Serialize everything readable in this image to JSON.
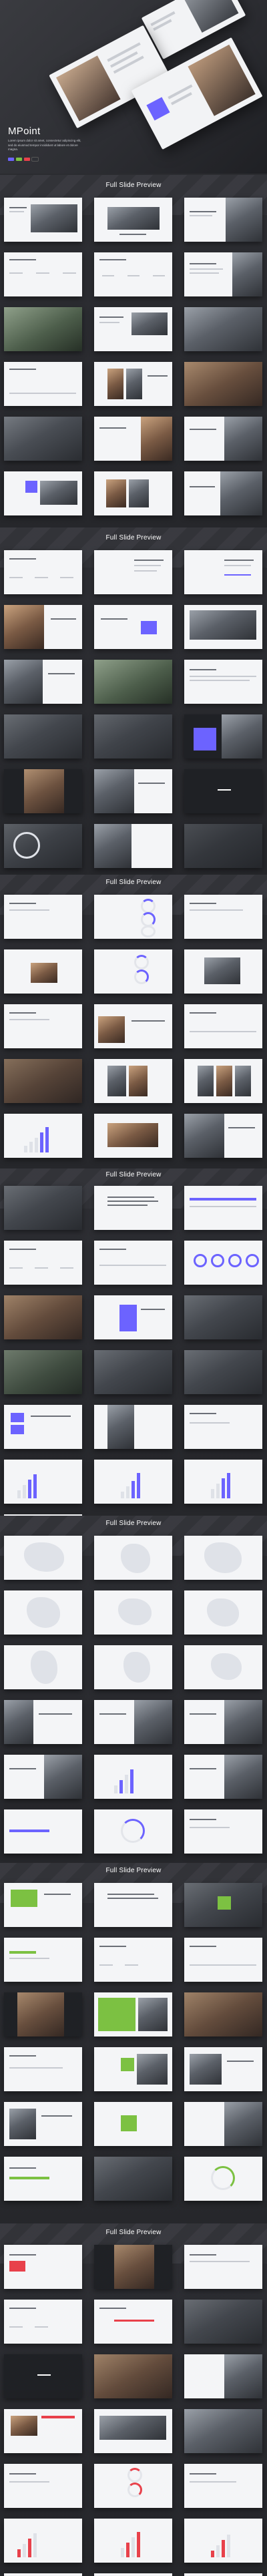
{
  "hero": {
    "title": "MPoint",
    "description": "Lorem ipsum dolor sit amet, consectetur adipiscing elit, sed do eiusmod tempor incididunt ut labore et dolore magna.",
    "color_dots": [
      "#6c63ff",
      "#7cc142",
      "#e8414b",
      "#2f3136"
    ]
  },
  "sections": [
    {
      "title": "Full Slide Preview",
      "accent": "#6c63ff"
    },
    {
      "title": "Full Slide Preview",
      "accent": "#6c63ff"
    },
    {
      "title": "Full Slide Preview",
      "accent": "#6c63ff"
    },
    {
      "title": "Full Slide Preview",
      "accent": "#6c63ff"
    },
    {
      "title": "Full Slide Preview",
      "accent": "#6c63ff"
    },
    {
      "title": "Full Slide Preview",
      "accent": "#7cc142"
    },
    {
      "title": "Full Slide Preview",
      "accent": "#e8414b"
    }
  ],
  "colors": {
    "background": "#2b2c30",
    "slide": "#f4f5f7",
    "purple": "#6c63ff",
    "green": "#7cc142",
    "red": "#e8414b"
  }
}
